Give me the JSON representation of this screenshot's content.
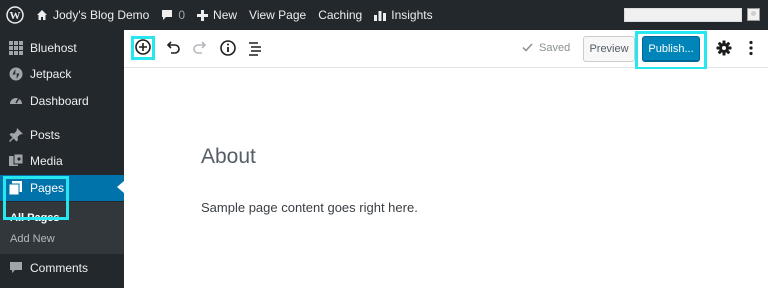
{
  "admin_bar": {
    "site_name": "Jody's Blog Demo",
    "comments_count": "0",
    "new_label": "New",
    "view_page_label": "View Page",
    "caching_label": "Caching",
    "insights_label": "Insights"
  },
  "sidebar": {
    "items": [
      {
        "label": "Bluehost",
        "icon": "grid-icon"
      },
      {
        "label": "Jetpack",
        "icon": "jetpack-icon"
      },
      {
        "label": "Dashboard",
        "icon": "dashboard-icon"
      },
      {
        "label": "Posts",
        "icon": "pin-icon"
      },
      {
        "label": "Media",
        "icon": "media-icon"
      },
      {
        "label": "Pages",
        "icon": "pages-icon"
      },
      {
        "label": "Comments",
        "icon": "comment-icon"
      }
    ],
    "submenu": {
      "all_pages": "All Pages",
      "add_new": "Add New"
    }
  },
  "toolbar": {
    "saved_label": "Saved",
    "preview_label": "Preview",
    "publish_label": "Publish..."
  },
  "content": {
    "title": "About",
    "body": "Sample page content goes right here."
  },
  "colors": {
    "admin_bg": "#23282d",
    "accent": "#0073aa",
    "publish_bg": "#0085ba",
    "highlight": "#26e7f0"
  }
}
